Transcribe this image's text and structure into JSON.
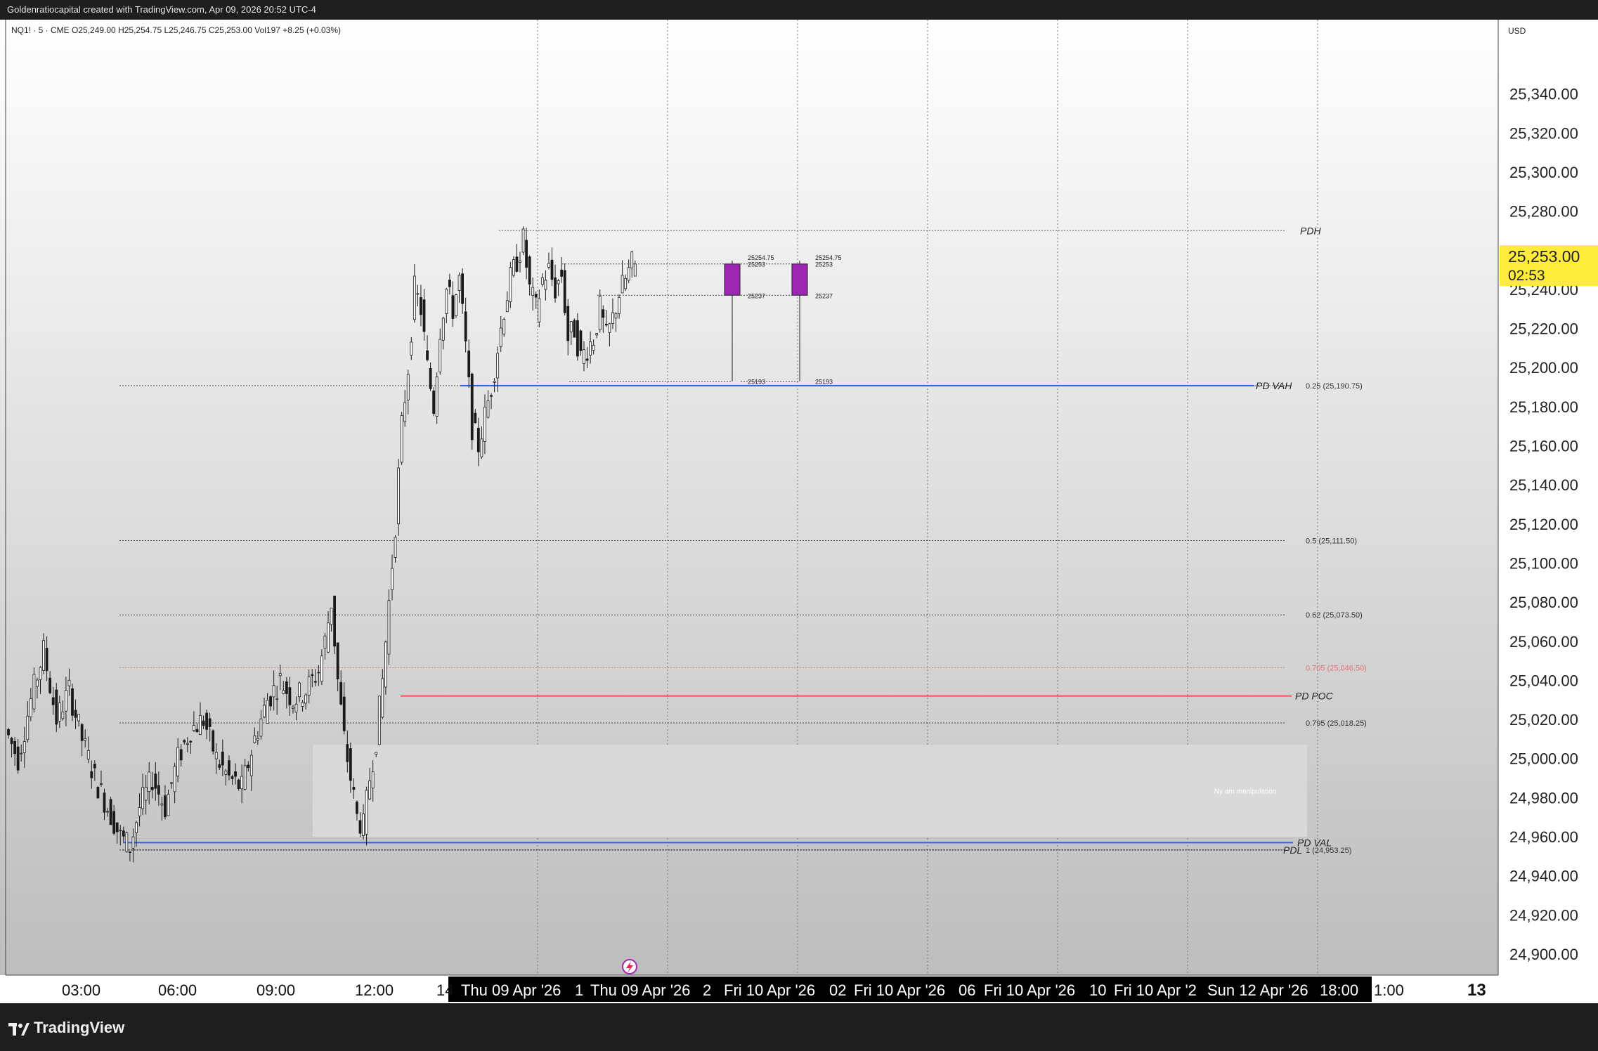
{
  "header": {
    "attribution": "Goldenratiocapital created with TradingView.com, Apr 09, 2026 20:52 UTC-4"
  },
  "symbol_bar": {
    "text": "NQ1! · 5 · CME   O25,249.00   H25,254.75   L25,246.75   C25,253.00   Vol197   +8.25 (+0.03%)"
  },
  "price_axis": {
    "currency": "USD",
    "current_price": "25,253.00",
    "countdown": "02:53",
    "accent_color": "#ffeb3b"
  },
  "footer": {
    "brand": "TradingView",
    "axis_end_label": "13"
  },
  "colors": {
    "candle": "#1a1a1a",
    "value_area_line": "#2962ff",
    "poc_line": "#e53935",
    "projection_candle": "#9c27b0",
    "fib_705": "#e57373"
  },
  "chart_data": {
    "type": "candlestick",
    "symbol": "NQ1!",
    "interval": "5",
    "exchange": "CME",
    "ylim": [
      24900,
      25360
    ],
    "y_ticks": [
      24900,
      24920,
      24940,
      24960,
      24980,
      25000,
      25020,
      25040,
      25060,
      25080,
      25100,
      25120,
      25140,
      25160,
      25180,
      25200,
      25220,
      25240,
      25260,
      25280,
      25300,
      25320,
      25340
    ],
    "y_tick_labels": [
      "24,900.00",
      "24,920.00",
      "24,940.00",
      "24,960.00",
      "24,980.00",
      "25,000.00",
      "25,020.00",
      "25,040.00",
      "25,060.00",
      "25,080.00",
      "25,100.00",
      "25,120.00",
      "25,140.00",
      "25,160.00",
      "25,180.00",
      "25,200.00",
      "25,220.00",
      "25,240.00",
      "25,260.00",
      "25,280.00",
      "25,300.00",
      "25,320.00",
      "25,340.00"
    ],
    "x_ticks": [
      "03:00",
      "06:00",
      "09:00",
      "12:00",
      "14",
      "Thu 09 Apr '26",
      "1",
      "Thu 09 Apr '26",
      "2",
      "Fri 10 Apr '26",
      "02",
      "Fri 10 Apr '26",
      "06",
      "Fri 10 Apr '26",
      "10",
      "Fri 10 Apr '2",
      "Sun 12 Apr '26",
      "18:00",
      "1:00"
    ],
    "price_path": [
      [
        0,
        25015
      ],
      [
        4,
        25000
      ],
      [
        8,
        25030
      ],
      [
        12,
        25055
      ],
      [
        16,
        25020
      ],
      [
        20,
        25035
      ],
      [
        24,
        25010
      ],
      [
        28,
        24990
      ],
      [
        32,
        24975
      ],
      [
        36,
        24960
      ],
      [
        39,
        24955
      ],
      [
        42,
        24975
      ],
      [
        46,
        24990
      ],
      [
        50,
        24975
      ],
      [
        54,
        25000
      ],
      [
        58,
        25015
      ],
      [
        62,
        25020
      ],
      [
        66,
        25000
      ],
      [
        70,
        24990
      ],
      [
        74,
        24985
      ],
      [
        78,
        25010
      ],
      [
        82,
        25030
      ],
      [
        86,
        25040
      ],
      [
        90,
        25030
      ],
      [
        94,
        25035
      ],
      [
        98,
        25045
      ],
      [
        100,
        25060
      ],
      [
        102,
        25080
      ],
      [
        104,
        25040
      ],
      [
        106,
        25010
      ],
      [
        108,
        24990
      ],
      [
        110,
        24970
      ],
      [
        112,
        24965
      ],
      [
        114,
        24990
      ],
      [
        116,
        25010
      ],
      [
        118,
        25040
      ],
      [
        120,
        25080
      ],
      [
        122,
        25120
      ],
      [
        124,
        25170
      ],
      [
        126,
        25200
      ],
      [
        128,
        25240
      ],
      [
        130,
        25230
      ],
      [
        132,
        25200
      ],
      [
        134,
        25180
      ],
      [
        136,
        25220
      ],
      [
        138,
        25240
      ],
      [
        140,
        25230
      ],
      [
        142,
        25245
      ],
      [
        144,
        25210
      ],
      [
        146,
        25170
      ],
      [
        148,
        25160
      ],
      [
        150,
        25175
      ],
      [
        152,
        25190
      ],
      [
        154,
        25210
      ],
      [
        156,
        25230
      ],
      [
        158,
        25245
      ],
      [
        160,
        25255
      ],
      [
        162,
        25265
      ],
      [
        164,
        25240
      ],
      [
        166,
        25230
      ],
      [
        168,
        25245
      ],
      [
        170,
        25250
      ],
      [
        172,
        25240
      ],
      [
        174,
        25248
      ],
      [
        176,
        25215
      ],
      [
        178,
        25220
      ],
      [
        180,
        25205
      ],
      [
        182,
        25210
      ],
      [
        184,
        25215
      ],
      [
        186,
        25230
      ],
      [
        188,
        25215
      ],
      [
        190,
        25225
      ],
      [
        192,
        25238
      ],
      [
        194,
        25245
      ],
      [
        196,
        25253
      ]
    ],
    "levels": [
      {
        "label": "PDH",
        "price": 25270
      },
      {
        "label": "PD VAH",
        "price": 25190.75
      },
      {
        "label": "PD POC",
        "price": 25032
      },
      {
        "label": "PD VAL",
        "price": 24957
      },
      {
        "label": "PDL",
        "price": 24953.25
      }
    ],
    "fib_levels": [
      {
        "label": "0.25 (25,190.75)",
        "price": 25190.75
      },
      {
        "label": "0.5 (25,111.50)",
        "price": 25111.5
      },
      {
        "label": "0.62 (25,073.50)",
        "price": 25073.5
      },
      {
        "label": "0.705 (25,046.50)",
        "price": 25046.5
      },
      {
        "label": "0.795 (25,018.25)",
        "price": 25018.25
      },
      {
        "label": "1 (24,953.25)",
        "price": 24953.25
      }
    ],
    "projection_candles": [
      {
        "open": 25237,
        "close": 25253,
        "high": 25254.75,
        "low": 25193,
        "labels": [
          "25254.75",
          "25253",
          "25237",
          "25193"
        ]
      },
      {
        "open": 25237,
        "close": 25253,
        "high": 25254.75,
        "low": 25193,
        "labels": [
          "25254.75",
          "25253",
          "25237",
          "25193"
        ]
      }
    ],
    "zone": {
      "label": "Ny am manipulation",
      "top": 25007,
      "bottom": 24960
    }
  }
}
